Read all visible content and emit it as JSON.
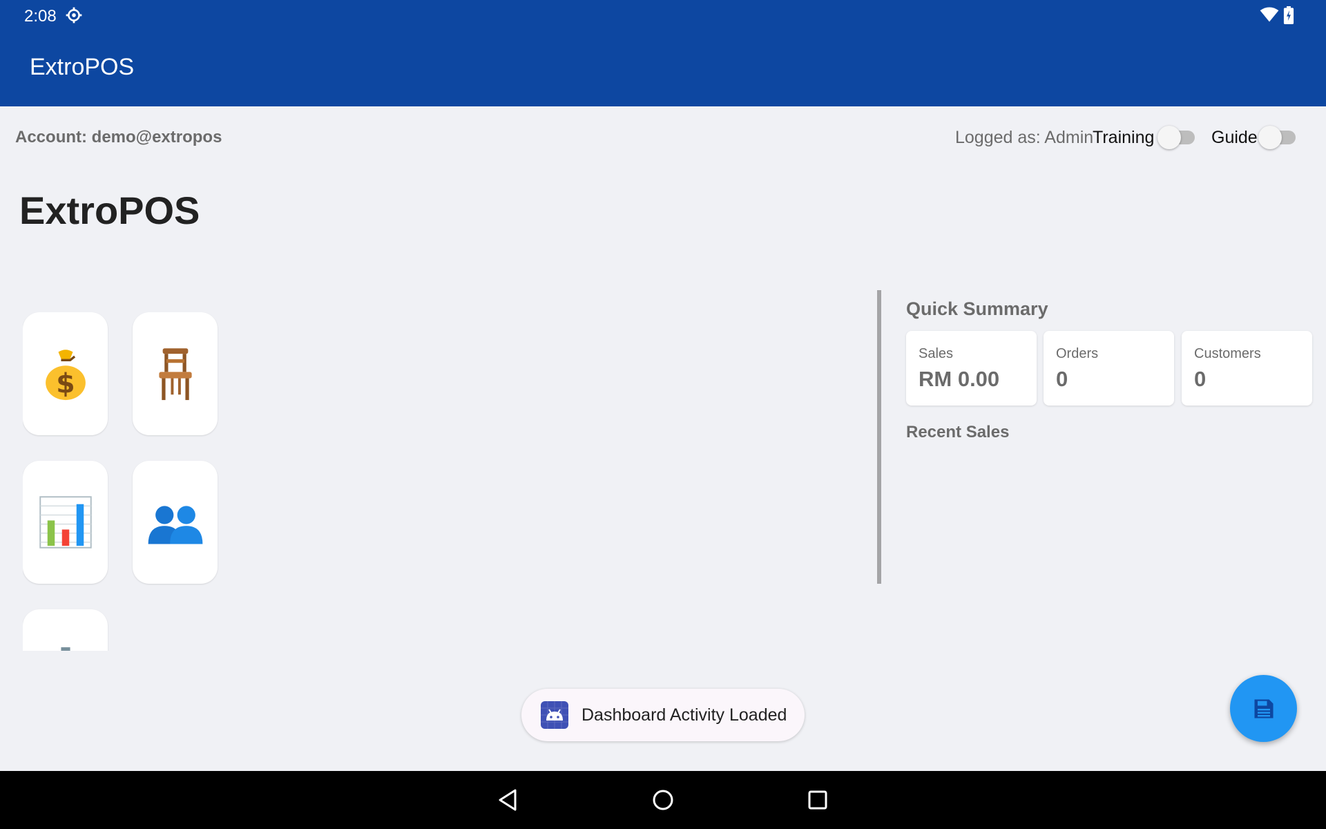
{
  "status_bar": {
    "time": "2:08"
  },
  "app_bar": {
    "title": "ExtroPOS"
  },
  "header": {
    "account": "Account: demo@extropos",
    "logged_as": "Logged as: Admin",
    "training_label": "Training",
    "guide_label": "Guide",
    "training_on": false,
    "guide_on": false
  },
  "headline": "ExtroPOS",
  "tiles": [
    {
      "icon": "money-bag-icon"
    },
    {
      "icon": "chair-icon"
    },
    {
      "icon": "bar-chart-icon"
    },
    {
      "icon": "people-icon"
    },
    {
      "icon": "gear-icon"
    }
  ],
  "quick_summary": {
    "title": "Quick Summary",
    "cards": [
      {
        "label": "Sales",
        "value": "RM 0.00"
      },
      {
        "label": "Orders",
        "value": "0"
      },
      {
        "label": "Customers",
        "value": "0"
      }
    ]
  },
  "recent_sales": {
    "title": "Recent Sales"
  },
  "toast": {
    "text": "Dashboard Activity Loaded"
  },
  "fab": {
    "icon": "save-icon"
  },
  "colors": {
    "primary": "#0d47a1",
    "fab": "#2196f3",
    "background": "#f0f1f5"
  }
}
